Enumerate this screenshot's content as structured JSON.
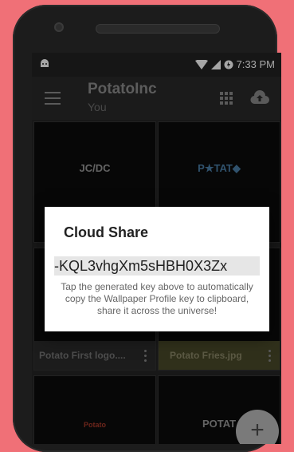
{
  "status": {
    "time": "7:33 PM"
  },
  "toolbar": {
    "title": "PotatoInc",
    "subtitle": "You"
  },
  "cards": [
    {
      "thumb": "JC/DC",
      "caption": ""
    },
    {
      "thumb": "P★TAT◆",
      "caption": ""
    },
    {
      "thumb": "",
      "caption": "Potato First logo...."
    },
    {
      "thumb": "",
      "caption": "Potato Fries.jpg"
    },
    {
      "thumb": "Potato",
      "caption": ""
    },
    {
      "thumb": "POTAT",
      "caption": ""
    }
  ],
  "fab": {
    "label": "+"
  },
  "dialog": {
    "title": "Cloud Share",
    "key": "-KQL3vhgXm5sHBH0X3Zx",
    "message": "Tap the generated key above to automatically copy the Wallpaper Profile key to clipboard, share it across the universe!"
  },
  "colors": {
    "background": "#f07077",
    "dialog": "#ffffff",
    "key_bg": "#e6e6e6"
  }
}
